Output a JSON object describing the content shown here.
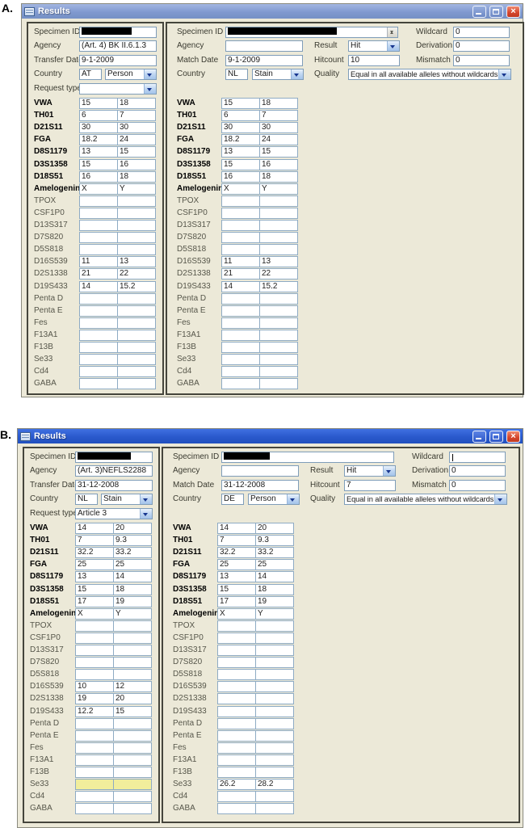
{
  "figure_labels": {
    "a": "A.",
    "b": "B."
  },
  "loci": [
    {
      "name": "VWA",
      "bold": true
    },
    {
      "name": "TH01",
      "bold": true
    },
    {
      "name": "D21S11",
      "bold": true
    },
    {
      "name": "FGA",
      "bold": true
    },
    {
      "name": "D8S1179",
      "bold": true
    },
    {
      "name": "D3S1358",
      "bold": true
    },
    {
      "name": "D18S51",
      "bold": true
    },
    {
      "name": "Amelogenin",
      "bold": true
    },
    {
      "name": "TPOX",
      "bold": false
    },
    {
      "name": "CSF1P0",
      "bold": false
    },
    {
      "name": "D13S317",
      "bold": false
    },
    {
      "name": "D7S820",
      "bold": false
    },
    {
      "name": "D5S818",
      "bold": false
    },
    {
      "name": "D16S539",
      "bold": false
    },
    {
      "name": "D2S1338",
      "bold": false
    },
    {
      "name": "D19S433",
      "bold": false
    },
    {
      "name": "Penta D",
      "bold": false
    },
    {
      "name": "Penta E",
      "bold": false
    },
    {
      "name": "Fes",
      "bold": false
    },
    {
      "name": "F13A1",
      "bold": false
    },
    {
      "name": "F13B",
      "bold": false
    },
    {
      "name": "Se33",
      "bold": false
    },
    {
      "name": "Cd4",
      "bold": false
    },
    {
      "name": "GABA",
      "bold": false
    }
  ],
  "windows": [
    {
      "title": "Results",
      "left_panel": {
        "specimen_label": "Specimen ID",
        "redact_width": 62,
        "agency_label": "Agency",
        "agency_value": "(Art. 4) BK II.6.1.3",
        "date_label": "Transfer Date",
        "date_value": "9-1-2009",
        "country_label": "Country",
        "country_code": "AT",
        "country_type": "Person",
        "request_label": "Request type",
        "request_value": "",
        "highlight": "",
        "alleles": [
          [
            "15",
            "18"
          ],
          [
            "6",
            "7"
          ],
          [
            "30",
            "30"
          ],
          [
            "18.2",
            "24"
          ],
          [
            "13",
            "15"
          ],
          [
            "15",
            "16"
          ],
          [
            "16",
            "18"
          ],
          [
            "X",
            "Y"
          ],
          [
            "",
            ""
          ],
          [
            "",
            ""
          ],
          [
            "",
            ""
          ],
          [
            "",
            ""
          ],
          [
            "",
            ""
          ],
          [
            "11",
            "13"
          ],
          [
            "21",
            "22"
          ],
          [
            "14",
            "15.2"
          ],
          [
            "",
            ""
          ],
          [
            "",
            ""
          ],
          [
            "",
            ""
          ],
          [
            "",
            ""
          ],
          [
            "",
            ""
          ],
          [
            "",
            ""
          ],
          [
            "",
            ""
          ],
          [
            "",
            ""
          ]
        ]
      },
      "right_panel": {
        "specimen_label": "Specimen ID",
        "redact_width": 135,
        "agency_label": "Agency",
        "agency_value": "",
        "date_label": "Match Date",
        "date_value": "9-1-2009",
        "country_label": "Country",
        "country_code": "NL",
        "country_type": "Stain",
        "highlight": "",
        "alleles": [
          [
            "15",
            "18"
          ],
          [
            "6",
            "7"
          ],
          [
            "30",
            "30"
          ],
          [
            "18.2",
            "24"
          ],
          [
            "13",
            "15"
          ],
          [
            "15",
            "16"
          ],
          [
            "16",
            "18"
          ],
          [
            "X",
            "Y"
          ],
          [
            "",
            ""
          ],
          [
            "",
            ""
          ],
          [
            "",
            ""
          ],
          [
            "",
            ""
          ],
          [
            "",
            ""
          ],
          [
            "11",
            "13"
          ],
          [
            "21",
            "22"
          ],
          [
            "14",
            "15.2"
          ],
          [
            "",
            ""
          ],
          [
            "",
            ""
          ],
          [
            "",
            ""
          ],
          [
            "",
            ""
          ],
          [
            "",
            ""
          ],
          [
            "",
            ""
          ],
          [
            "",
            ""
          ],
          [
            "",
            ""
          ]
        ]
      },
      "match_fields": {
        "result_label": "Result",
        "result_value": "Hit",
        "hitcount_label": "Hitcount",
        "hitcount_value": "10",
        "quality_label": "Quality",
        "quality_value": "Equal in all available alleles without wildcards",
        "wildcard_label": "Wildcard",
        "wildcard_value": "0",
        "derivation_label": "Derivation",
        "derivation_value": "0",
        "mismatch_label": "Mismatch",
        "mismatch_value": "0"
      }
    },
    {
      "title": "Results",
      "left_panel": {
        "specimen_label": "Specimen ID",
        "redact_width": 66,
        "agency_label": "Agency",
        "agency_value": "(Art. 3)NEFLS2288",
        "date_label": "Transfer Date",
        "date_value": "31-12-2008",
        "country_label": "Country",
        "country_code": "NL",
        "country_type": "Stain",
        "request_label": "Request type",
        "request_value": "Article 3",
        "highlight": "Se33",
        "alleles": [
          [
            "14",
            "20"
          ],
          [
            "7",
            "9.3"
          ],
          [
            "32.2",
            "33.2"
          ],
          [
            "25",
            "25"
          ],
          [
            "13",
            "14"
          ],
          [
            "15",
            "18"
          ],
          [
            "17",
            "19"
          ],
          [
            "X",
            "Y"
          ],
          [
            "",
            ""
          ],
          [
            "",
            ""
          ],
          [
            "",
            ""
          ],
          [
            "",
            ""
          ],
          [
            "",
            ""
          ],
          [
            "10",
            "12"
          ],
          [
            "19",
            "20"
          ],
          [
            "12.2",
            "15"
          ],
          [
            "",
            ""
          ],
          [
            "",
            ""
          ],
          [
            "",
            ""
          ],
          [
            "",
            ""
          ],
          [
            "",
            ""
          ],
          [
            "",
            ""
          ],
          [
            "",
            ""
          ],
          [
            "",
            ""
          ]
        ]
      },
      "right_panel": {
        "specimen_label": "Specimen ID",
        "redact_width": 57,
        "agency_label": "Agency",
        "agency_value": "",
        "date_label": "Match Date",
        "date_value": "31-12-2008",
        "country_label": "Country",
        "country_code": "DE",
        "country_type": "Person",
        "highlight": "",
        "alleles": [
          [
            "14",
            "20"
          ],
          [
            "7",
            "9.3"
          ],
          [
            "32.2",
            "33.2"
          ],
          [
            "25",
            "25"
          ],
          [
            "13",
            "14"
          ],
          [
            "15",
            "18"
          ],
          [
            "17",
            "19"
          ],
          [
            "X",
            "Y"
          ],
          [
            "",
            ""
          ],
          [
            "",
            ""
          ],
          [
            "",
            ""
          ],
          [
            "",
            ""
          ],
          [
            "",
            ""
          ],
          [
            "",
            ""
          ],
          [
            "",
            ""
          ],
          [
            "",
            ""
          ],
          [
            "",
            ""
          ],
          [
            "",
            ""
          ],
          [
            "",
            ""
          ],
          [
            "",
            ""
          ],
          [
            "",
            ""
          ],
          [
            "26.2",
            "28.2"
          ],
          [
            "",
            ""
          ],
          [
            "",
            ""
          ]
        ]
      },
      "match_fields": {
        "result_label": "Result",
        "result_value": "Hit",
        "hitcount_label": "Hitcount",
        "hitcount_value": "7",
        "quality_label": "Quality",
        "quality_value": "Equal in all available alleles without wildcards",
        "wildcard_label": "Wildcard",
        "wildcard_value": "",
        "derivation_label": "Derivation",
        "derivation_value": "0",
        "mismatch_label": "Mismatch",
        "mismatch_value": "0"
      }
    }
  ]
}
